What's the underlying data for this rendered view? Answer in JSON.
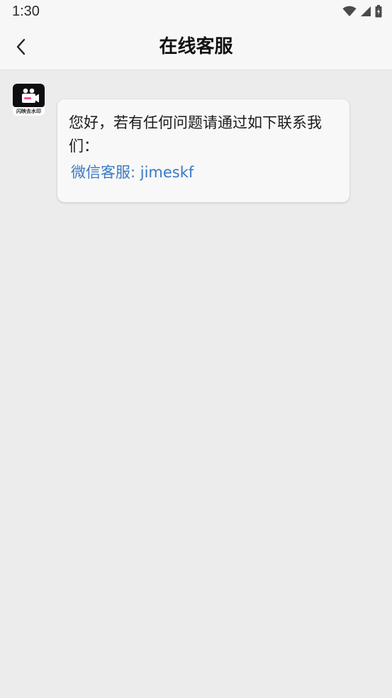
{
  "status_bar": {
    "time": "1:30",
    "icons": [
      "wifi-icon",
      "signal-icon",
      "battery-icon"
    ]
  },
  "app_bar": {
    "back_icon": "chevron-left-icon",
    "title": "在线客服"
  },
  "chat": {
    "avatar_caption": "闪映去水印",
    "message_text": "您好，若有任何问题请通过如下联系我们：",
    "contact_link": "微信客服: jimeskf"
  },
  "colors": {
    "background": "#ececec",
    "bar_background": "#f7f7f7",
    "bubble_background": "#f8f8f8",
    "link": "#3a79c6",
    "text": "#1c1c1c"
  }
}
